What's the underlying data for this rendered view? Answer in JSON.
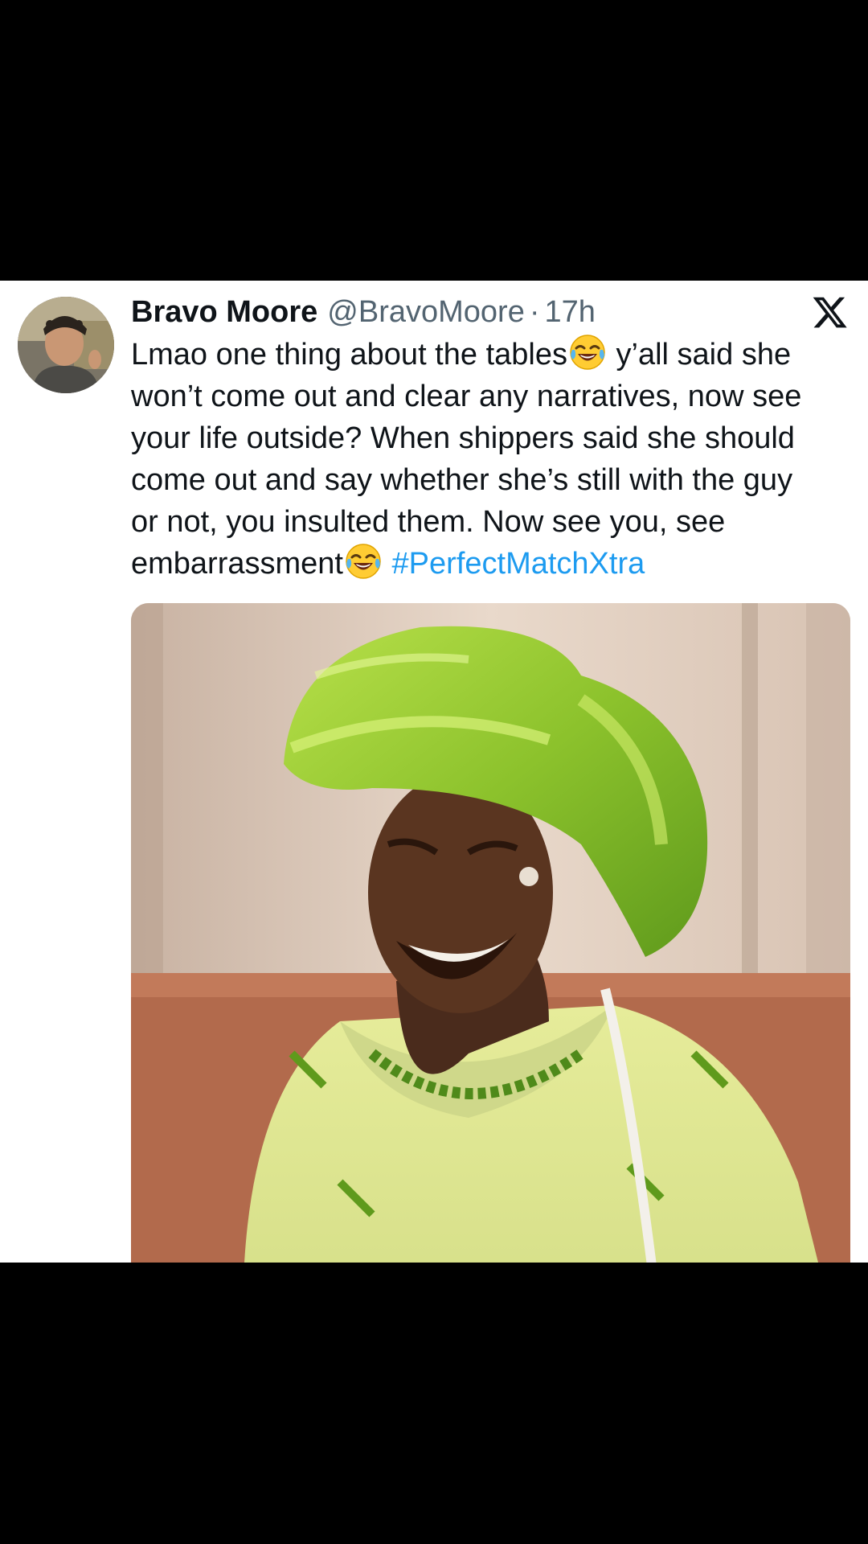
{
  "tweet": {
    "display_name": "Bravo Moore",
    "handle": "@BravoMoore",
    "separator": "·",
    "time": "17h",
    "logo_icon": "x-logo-icon",
    "text_lines": [
      "Lmao one thing about the tables",
      "y’all said she",
      "won’t come out and clear any narratives, now see",
      "your life outside? When shippers said she should",
      "come out and say whether she’s still with the guy",
      "or not, you insulted them. Now see you, see",
      "embarrassment"
    ],
    "hashtag": "#PerfectMatchXtra",
    "emoji_icon": "face-with-tears-of-joy-icon",
    "media_description": "laughing woman photo",
    "colors": {
      "hashtag": "#1d9bf0",
      "text": "#0f1419",
      "secondary": "#536471",
      "background": "#ffffff",
      "outer": "#000000"
    }
  }
}
